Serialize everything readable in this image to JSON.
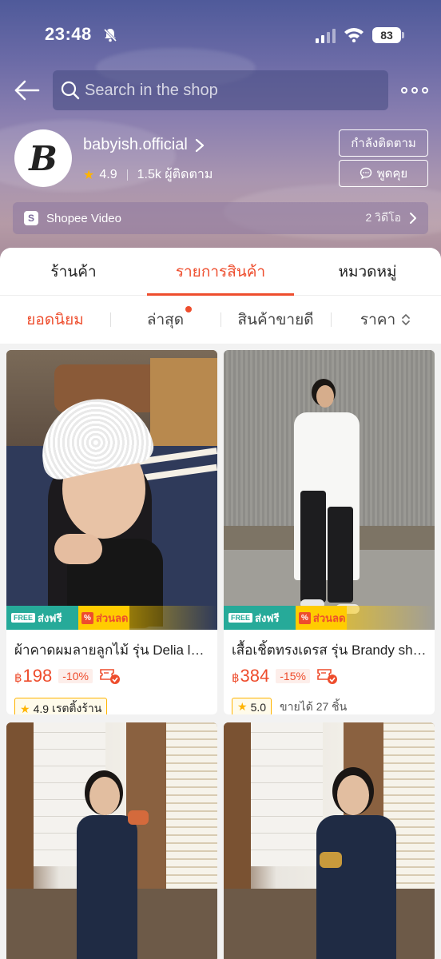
{
  "status_bar": {
    "time": "23:48",
    "battery": "83"
  },
  "search": {
    "placeholder": "Search in the shop"
  },
  "shop": {
    "avatar_letter": "B",
    "name": "babyish.official",
    "rating": "4.9",
    "followers": "1.5k ผู้ติดตาม",
    "follow_button": "กำลังติดตาม",
    "chat_button": "พูดคุย"
  },
  "video": {
    "label": "Shopee Video",
    "count": "2 วิดีโอ"
  },
  "tabs": [
    {
      "label": "ร้านค้า",
      "active": false
    },
    {
      "label": "รายการสินค้า",
      "active": true
    },
    {
      "label": "หมวดหมู่",
      "active": false
    }
  ],
  "sort": [
    {
      "label": "ยอดนิยม",
      "active": true
    },
    {
      "label": "ล่าสุด",
      "active": false,
      "dot": true
    },
    {
      "label": "สินค้าขายดี",
      "active": false
    },
    {
      "label": "ราคา",
      "active": false
    }
  ],
  "badges": {
    "free_tag": "FREE",
    "free_text": "ส่งฟรี",
    "disc_tag": "%",
    "disc_text": "ส่วนลด"
  },
  "products": [
    {
      "title": "ผ้าคาดผมลายลูกไม้ รุ่น Delia lace headband",
      "currency": "฿",
      "price": "198",
      "discount": "-10%",
      "rating": "4.9",
      "meta": "เรตติ้งร้าน"
    },
    {
      "title": "เสื้อเชิ้ตทรงเดรส รุ่น Brandy shirt dress",
      "currency": "฿",
      "price": "384",
      "discount": "-15%",
      "rating": "5.0",
      "meta": "ขายได้ 27 ชิ้น"
    }
  ],
  "colors": {
    "accent": "#ee4d2d",
    "free_badge": "#26aa99",
    "discount_badge": "#ffcc00",
    "star": "#ffb400"
  }
}
